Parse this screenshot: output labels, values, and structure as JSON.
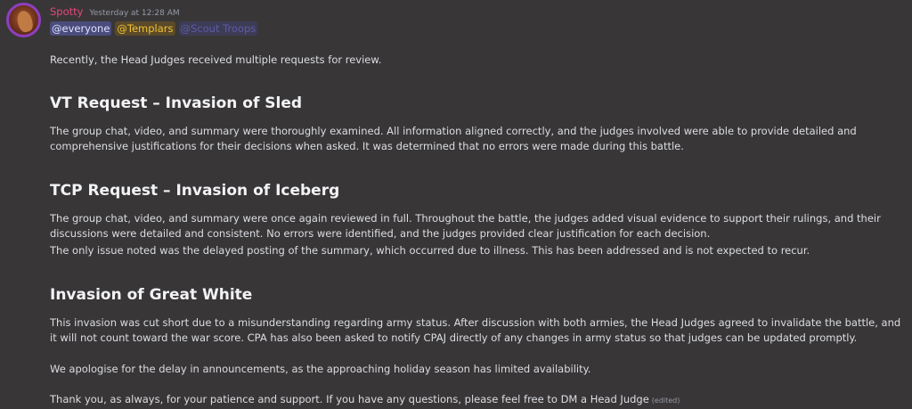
{
  "message": {
    "username": "Spotty",
    "timestamp": "Yesterday at 12:28 AM",
    "mentions": [
      "@everyone",
      "@Templars",
      "@Scout Troops"
    ],
    "intro": "Recently, the Head Judges received multiple requests for review.",
    "sections": [
      {
        "heading": "VT Request – Invasion of Sled",
        "paragraphs": [
          "The group chat, video, and summary were thoroughly examined. All information aligned correctly, and the judges involved were able to provide detailed and comprehensive justifications for their decisions when asked. It was determined that no errors were made during this battle."
        ]
      },
      {
        "heading": "TCP Request – Invasion of Iceberg",
        "paragraphs": [
          "The group chat, video, and summary were once again reviewed in full. Throughout the battle, the judges added visual evidence to support their rulings, and their discussions were detailed and consistent. No errors were identified, and the judges provided clear justification for each decision.",
          "The only issue noted was the delayed posting of the summary, which occurred due to illness. This has been addressed and is not expected to recur."
        ]
      },
      {
        "heading": "Invasion of Great White",
        "paragraphs": [
          "This invasion was cut short due to a misunderstanding regarding army status. After discussion with both armies, the Head Judges agreed to invalidate the battle, and it will not count toward the war score. CPA has also been asked to notify CPAJ directly of any changes in army status so that judges can be updated promptly."
        ]
      }
    ],
    "apology": "We apologise for the delay in announcements, as the approaching holiday season has limited availability.",
    "closing": "Thank you, as always, for your patience and support. If you have any questions, please feel free to DM a Head Judge",
    "edited_label": "(edited)"
  }
}
